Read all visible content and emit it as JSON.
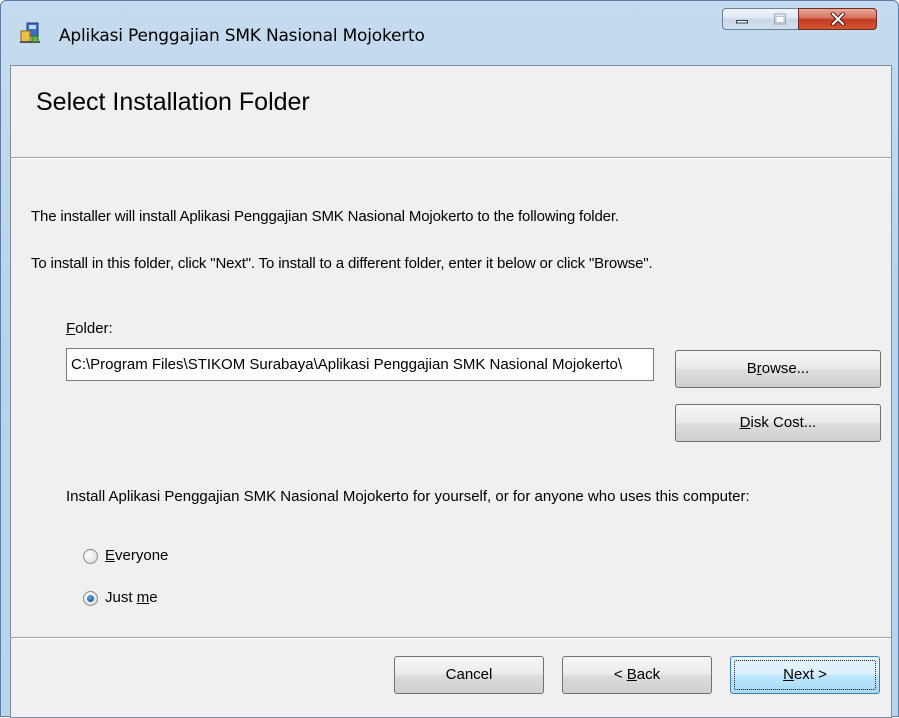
{
  "window": {
    "title": "Aplikasi Penggajian SMK Nasional Mojokerto",
    "controls": [
      "minimize-icon",
      "maximize-icon",
      "close-icon"
    ]
  },
  "page": {
    "title": "Select Installation Folder",
    "intro_line_1": "The installer will install Aplikasi Penggajian SMK Nasional Mojokerto to the following folder.",
    "intro_line_2": "To install in this folder, click \"Next\". To install to a different folder, enter it below or click \"Browse\"."
  },
  "folder": {
    "label_mnemonic": "F",
    "label_rest": "older:",
    "value": "C:\\Program Files\\STIKOM Surabaya\\Aplikasi Penggajian SMK Nasional Mojokerto\\",
    "browse_before": "B",
    "browse_mnemonic": "r",
    "browse_after": "owse...",
    "diskcost_mnemonic": "D",
    "diskcost_after": "isk Cost..."
  },
  "scope": {
    "question": "Install Aplikasi Penggajian SMK Nasional Mojokerto for yourself, or for anyone who uses this computer:",
    "everyone_mnemonic": "E",
    "everyone_rest": "veryone",
    "justme_before": "Just ",
    "justme_mnemonic": "m",
    "justme_after": "e",
    "selected": "Just me"
  },
  "buttons": {
    "cancel": "Cancel",
    "back_before": "< ",
    "back_mnemonic": "B",
    "back_after": "ack",
    "next_mnemonic": "N",
    "next_after": "ext >"
  },
  "colors": {
    "frame_accent": "#b9d1ea",
    "close_button": "#c33b24",
    "default_button": "#3c7fb1",
    "dialog_background": "#f0f0f0"
  }
}
